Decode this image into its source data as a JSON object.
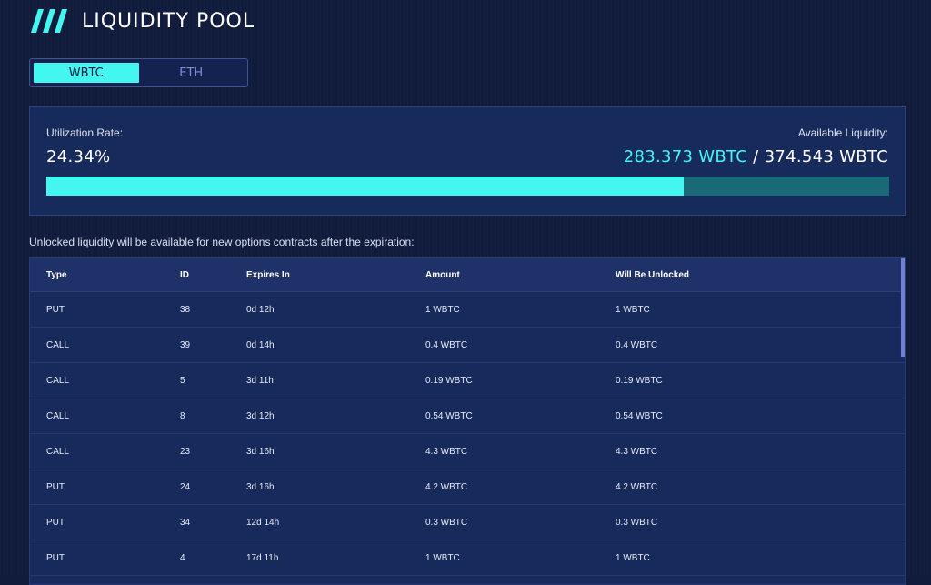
{
  "page": {
    "title": "LIQUIDITY POOL",
    "icon": "triple-slash-icon",
    "accent": "#43f7f0"
  },
  "token_switch": {
    "tabs": [
      {
        "label": "WBTC",
        "active": true
      },
      {
        "label": "ETH",
        "active": false
      }
    ]
  },
  "stats": {
    "utilization_label": "Utilization Rate:",
    "utilization_value": "24.34%",
    "available_label": "Available Liquidity:",
    "available_value": "283.373 WBTC",
    "separator": " / ",
    "total_value": "374.543 WBTC",
    "available_fraction": 0.7566
  },
  "note": "Unlocked liquidity will be available for new options contracts after the expiration:",
  "table": {
    "columns": [
      "Type",
      "ID",
      "Expires In",
      "Amount",
      "Will Be Unlocked"
    ],
    "rows": [
      [
        "PUT",
        "38",
        "0d 12h",
        "1 WBTC",
        "1 WBTC"
      ],
      [
        "CALL",
        "39",
        "0d 14h",
        "0.4 WBTC",
        "0.4 WBTC"
      ],
      [
        "CALL",
        "5",
        "3d 11h",
        "0.19 WBTC",
        "0.19 WBTC"
      ],
      [
        "CALL",
        "8",
        "3d 12h",
        "0.54 WBTC",
        "0.54 WBTC"
      ],
      [
        "CALL",
        "23",
        "3d 16h",
        "4.3 WBTC",
        "4.3 WBTC"
      ],
      [
        "PUT",
        "24",
        "3d 16h",
        "4.2 WBTC",
        "4.2 WBTC"
      ],
      [
        "PUT",
        "34",
        "12d 14h",
        "0.3 WBTC",
        "0.3 WBTC"
      ],
      [
        "PUT",
        "4",
        "17d 11h",
        "1 WBTC",
        "1 WBTC"
      ]
    ]
  }
}
